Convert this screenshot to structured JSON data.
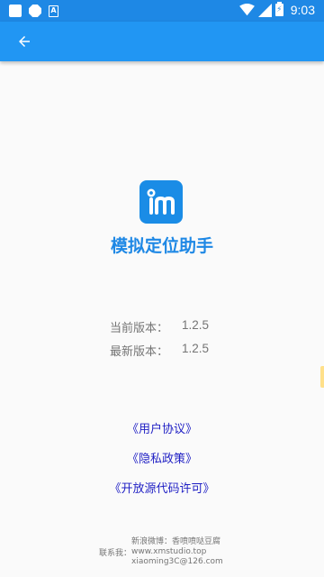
{
  "status_bar": {
    "time": "9:03",
    "battery_level": "⚡",
    "icons": [
      "notification-square-icon",
      "notification-stop-icon",
      "notification-a-icon",
      "wifi-icon",
      "signal-icon",
      "battery-charging-icon"
    ]
  },
  "app_bar": {
    "back_icon": "arrow-back-icon",
    "color": "#2196f3"
  },
  "about": {
    "app_name": "模拟定位助手",
    "current_version_label": "当前版本：",
    "current_version": "1.2.5",
    "latest_version_label": "最新版本：",
    "latest_version": "1.2.5"
  },
  "links": {
    "user_agreement": "《用户协议》",
    "privacy_policy": "《隐私政策》",
    "open_source": "《开放源代码许可》"
  },
  "contact": {
    "label": "联系我：",
    "weibo": "新浪微博：香喷喷哒豆腐",
    "website": "www.xmstudio.top",
    "email": "xiaoming3C@126.com"
  },
  "colors": {
    "primary": "#2196f3",
    "accent_text": "#1e88e5",
    "link": "#1f1fc4"
  }
}
